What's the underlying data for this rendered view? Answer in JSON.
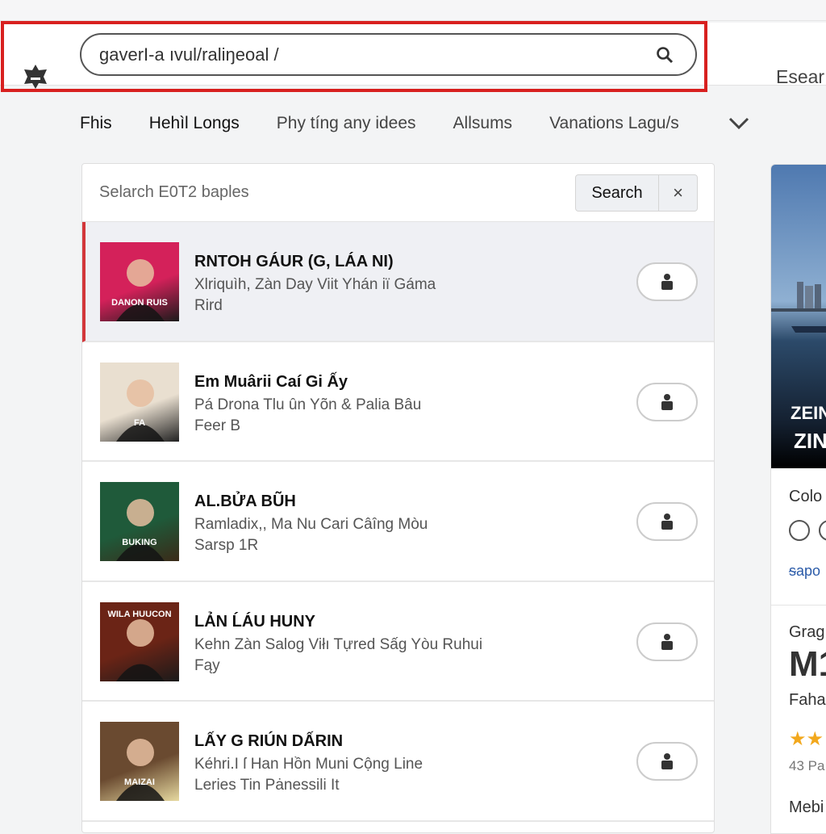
{
  "header": {
    "url_value": "gaverI-a ıvul/raliŋeoal /",
    "right_label": "Esear",
    "logo_icon": "star-badge-icon",
    "highlight_color": "#d8201f"
  },
  "tabs": [
    {
      "label": "Fhis"
    },
    {
      "label": "Hehìl Longs"
    },
    {
      "label": "Phy tíng any idees"
    },
    {
      "label": "Allsums"
    },
    {
      "label": "Vanations Lagu/s"
    }
  ],
  "panel": {
    "search_placeholder": "Selarch E0T2 baples",
    "search_button": "Search",
    "close_button": "×",
    "rows": [
      {
        "title": "RNTOH GÁUR (G, LÁA NI)",
        "line1": "Xlriquìh, Zàn Day Viit Yhán iï Gáma",
        "line2": "Rird",
        "thumb_text": "DANON RUIS",
        "colors": [
          "#d4215a",
          "#1b1b1b"
        ]
      },
      {
        "title": "Em Muârii Caí Gi Ấy",
        "line1": "Pá Drona Tlu ûn Yõn & Palia Bâu",
        "line2": "Feer B",
        "thumb_text": "FA",
        "colors": [
          "#e9dfd0",
          "#222"
        ]
      },
      {
        "title": "AL.BỬA BŨH",
        "line1": "Ramladix,, Ma Nu Cari Câîng Mòu",
        "line2": "Sarsp 1R",
        "thumb_text": "BUKING",
        "colors": [
          "#1f5a3a",
          "#3a2a18"
        ]
      },
      {
        "title": "LẢN ĹÁU HUNY",
        "line1": "Kehn Zàn Salog Viłı Tựred Sấg Yòu Ruhui",
        "line2": "Fąy",
        "thumb_text": "WILA HUUCON",
        "colors": [
          "#6b2416",
          "#1a1a1a"
        ]
      },
      {
        "title": "LẤY G RIÚN DẤRIN",
        "line1": "Kéhri.I ſ Han Hồn Muni Cộng Line",
        "line2": "Leries Tin Pȧnessili It",
        "thumb_text": "MAIZAI",
        "colors": [
          "#6a4a30",
          "#e6d9a0"
        ]
      }
    ]
  },
  "right_card": {
    "image_caption_1": "ZEIN",
    "image_caption_2": "ZIN",
    "label_1": "Colo",
    "link": "ᵴapo",
    "label_2": "Grag",
    "big": "M1",
    "label_3": "Faha",
    "rating": 2,
    "reviews": "43 Pa",
    "label_4": "Mebi",
    "star_color": "#f2a81d"
  }
}
